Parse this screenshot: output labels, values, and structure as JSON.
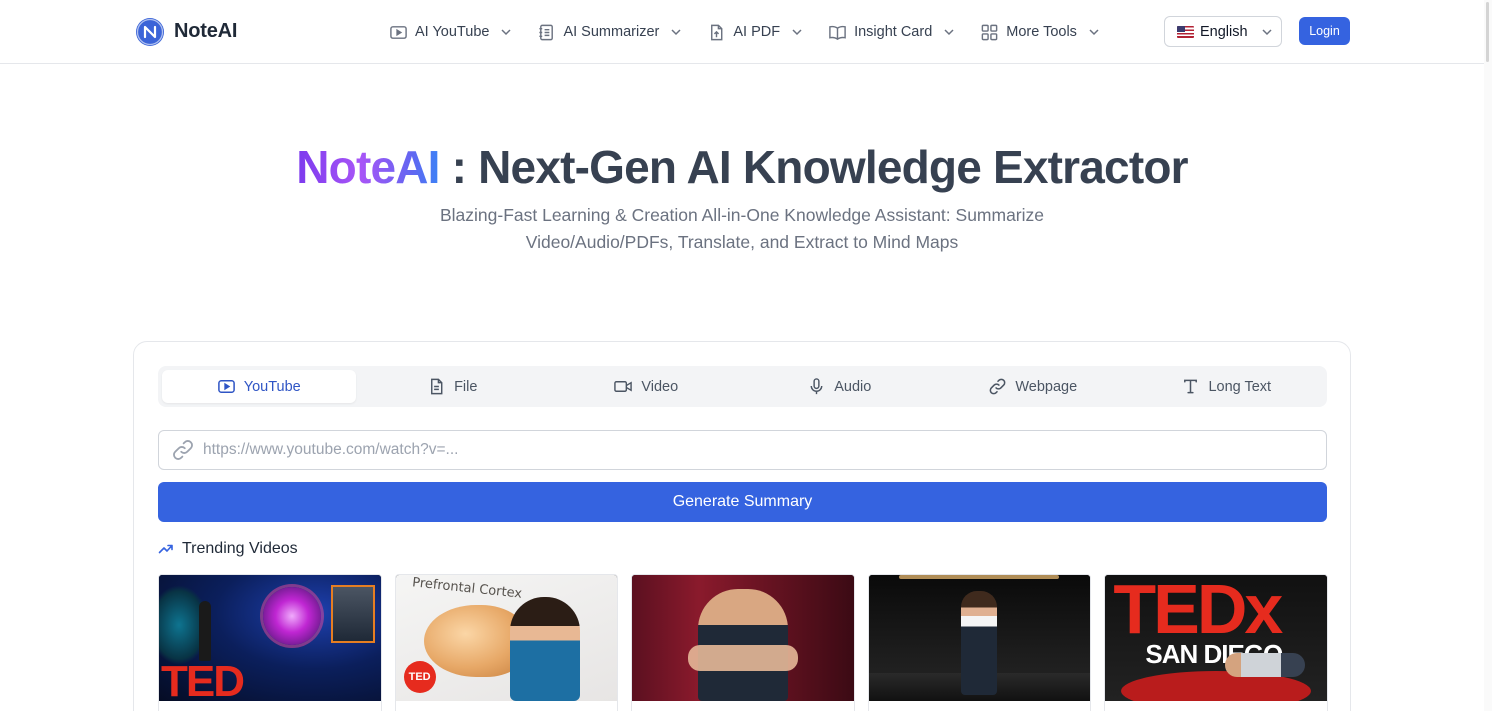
{
  "brand": {
    "name": "NoteAI",
    "logo_letter": "N"
  },
  "nav": [
    {
      "label": "AI YouTube",
      "icon": "video-player-icon"
    },
    {
      "label": "AI Summarizer",
      "icon": "notebook-icon"
    },
    {
      "label": "AI PDF",
      "icon": "file-upload-icon"
    },
    {
      "label": "Insight Card",
      "icon": "open-book-icon"
    },
    {
      "label": "More Tools",
      "icon": "grid-icon"
    }
  ],
  "language": {
    "selected": "English",
    "flag": "us-flag"
  },
  "login_label": "Login",
  "hero": {
    "title_brand": "NoteAI",
    "title_rest": " : Next-Gen AI Knowledge Extractor",
    "subtitle": "Blazing-Fast Learning & Creation All-in-One Knowledge Assistant: Summarize Video/Audio/PDFs, Translate, and Extract to Mind Maps"
  },
  "tabs": [
    {
      "label": "YouTube",
      "icon": "youtube-play-icon",
      "active": true
    },
    {
      "label": "File",
      "icon": "document-icon",
      "active": false
    },
    {
      "label": "Video",
      "icon": "video-camera-icon",
      "active": false
    },
    {
      "label": "Audio",
      "icon": "microphone-icon",
      "active": false
    },
    {
      "label": "Webpage",
      "icon": "link-icon",
      "active": false
    },
    {
      "label": "Long Text",
      "icon": "text-type-icon",
      "active": false
    }
  ],
  "url_input": {
    "placeholder": "https://www.youtube.com/watch?v=...",
    "value": ""
  },
  "generate_label": "Generate Summary",
  "trending": {
    "title": "Trending Videos",
    "videos": [
      {
        "thumb_text": "TED"
      },
      {
        "thumb_text": "Prefrontal Cortex",
        "badge": "TED"
      },
      {
        "thumb_text": ""
      },
      {
        "thumb_text": ""
      },
      {
        "thumb_text": "TEDx",
        "thumb_subtext": "SAN DIEGO"
      }
    ]
  },
  "colors": {
    "primary": "#3563e0",
    "active_tab_text": "#2f55c5",
    "ted_red": "#e62b1e"
  }
}
